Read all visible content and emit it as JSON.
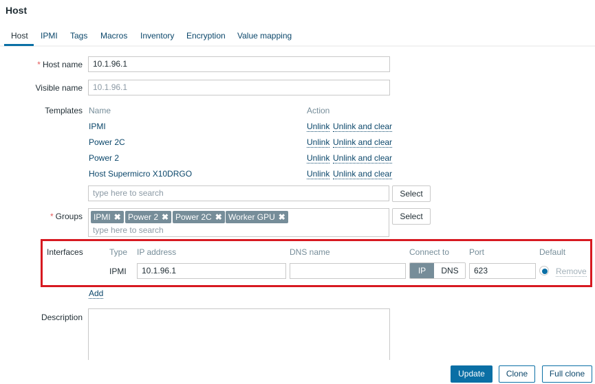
{
  "page": {
    "title": "Host"
  },
  "tabs": [
    {
      "label": "Host",
      "active": true
    },
    {
      "label": "IPMI",
      "active": false
    },
    {
      "label": "Tags",
      "active": false
    },
    {
      "label": "Macros",
      "active": false
    },
    {
      "label": "Inventory",
      "active": false
    },
    {
      "label": "Encryption",
      "active": false
    },
    {
      "label": "Value mapping",
      "active": false
    }
  ],
  "form": {
    "host_name": {
      "label": "Host name",
      "required_mark": "*",
      "value": "10.1.96.1"
    },
    "visible_name": {
      "label": "Visible name",
      "placeholder": "10.1.96.1"
    },
    "templates": {
      "label": "Templates",
      "col_name": "Name",
      "col_action": "Action",
      "items": [
        {
          "name": "IPMI",
          "unlink": "Unlink",
          "unlink_clear": "Unlink and clear"
        },
        {
          "name": "Power 2C",
          "unlink": "Unlink",
          "unlink_clear": "Unlink and clear"
        },
        {
          "name": "Power 2",
          "unlink": "Unlink",
          "unlink_clear": "Unlink and clear"
        },
        {
          "name": "Host Supermicro X10DRGO",
          "unlink": "Unlink",
          "unlink_clear": "Unlink and clear"
        }
      ],
      "search_placeholder": "type here to search",
      "select_label": "Select"
    },
    "groups": {
      "label": "Groups",
      "required_mark": "*",
      "tags": [
        "IPMI",
        "Power 2",
        "Power 2C",
        "Worker GPU"
      ],
      "remove_glyph": "✖",
      "search_placeholder": "type here to search",
      "select_label": "Select"
    },
    "interfaces": {
      "label": "Interfaces",
      "col_type": "Type",
      "col_ip": "IP address",
      "col_dns": "DNS name",
      "col_connect": "Connect to",
      "col_port": "Port",
      "col_default": "Default",
      "rows": [
        {
          "type": "IPMI",
          "ip": "10.1.96.1",
          "dns": "",
          "connect_ip": "IP",
          "connect_dns": "DNS",
          "connect_selected": "IP",
          "port": "623",
          "default": true,
          "remove": "Remove"
        }
      ],
      "add_label": "Add",
      "highlight_color": "#d71920"
    },
    "description": {
      "label": "Description",
      "value": ""
    }
  },
  "actions": {
    "update": "Update",
    "clone": "Clone",
    "full_clone": "Full clone"
  },
  "colors": {
    "primary": "#0a6fa5",
    "link": "#0a466a",
    "tag_bg": "#768d99",
    "required": "#e45959"
  }
}
